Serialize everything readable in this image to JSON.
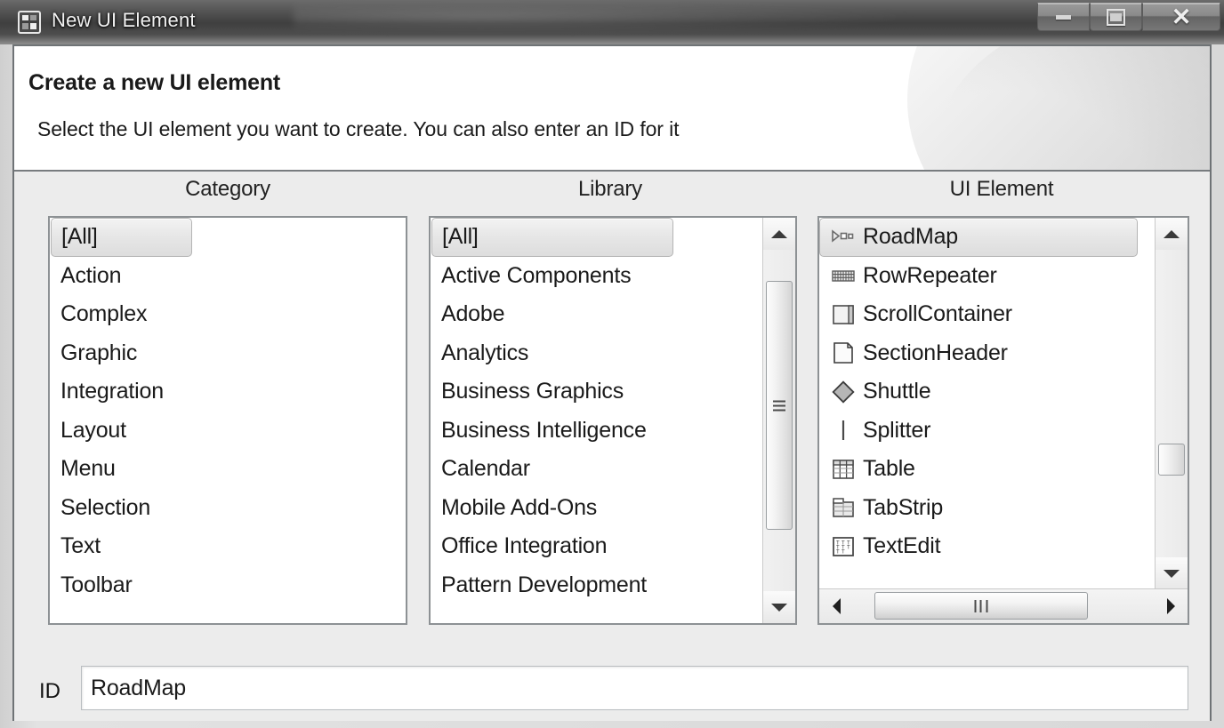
{
  "window": {
    "title": "New UI Element",
    "title_icon": "ui-element-icon",
    "buttons": {
      "minimize": {
        "name": "minimize-button",
        "glyph": "minimize-icon"
      },
      "maximize": {
        "name": "maximize-button",
        "glyph": "maximize-icon"
      },
      "close": {
        "name": "close-button",
        "glyph": "close-icon",
        "label": "✕"
      }
    }
  },
  "banner": {
    "title": "Create a new UI element",
    "subtitle": "Select the UI element you want to create. You can also enter an ID for it"
  },
  "columns": {
    "category": {
      "title": "Category",
      "items": [
        {
          "label": "[All]",
          "selected": true
        },
        {
          "label": "Action",
          "selected": false
        },
        {
          "label": "Complex",
          "selected": false
        },
        {
          "label": "Graphic",
          "selected": false
        },
        {
          "label": "Integration",
          "selected": false
        },
        {
          "label": "Layout",
          "selected": false
        },
        {
          "label": "Menu",
          "selected": false
        },
        {
          "label": "Selection",
          "selected": false
        },
        {
          "label": "Text",
          "selected": false
        },
        {
          "label": "Toolbar",
          "selected": false
        }
      ]
    },
    "library": {
      "title": "Library",
      "items": [
        {
          "label": "[All]",
          "selected": true
        },
        {
          "label": "Active Components",
          "selected": false
        },
        {
          "label": "Adobe",
          "selected": false
        },
        {
          "label": "Analytics",
          "selected": false
        },
        {
          "label": "Business Graphics",
          "selected": false
        },
        {
          "label": "Business Intelligence",
          "selected": false
        },
        {
          "label": "Calendar",
          "selected": false
        },
        {
          "label": "Mobile Add-Ons",
          "selected": false
        },
        {
          "label": "Office Integration",
          "selected": false
        },
        {
          "label": "Pattern Development",
          "selected": false
        }
      ],
      "scrollbar": {
        "thumb_top_pct": 9,
        "thumb_height_pct": 73
      }
    },
    "ui_element": {
      "title": "UI Element",
      "items": [
        {
          "label": "RoadMap",
          "icon": "roadmap-icon",
          "selected": true
        },
        {
          "label": "RowRepeater",
          "icon": "rowrepeater-icon",
          "selected": false
        },
        {
          "label": "ScrollContainer",
          "icon": "scrollcontainer-icon",
          "selected": false
        },
        {
          "label": "SectionHeader",
          "icon": "sectionheader-icon",
          "selected": false
        },
        {
          "label": "Shuttle",
          "icon": "shuttle-icon",
          "selected": false
        },
        {
          "label": "Splitter",
          "icon": "splitter-icon",
          "selected": false
        },
        {
          "label": "Table",
          "icon": "table-icon",
          "selected": false
        },
        {
          "label": "TabStrip",
          "icon": "tabstrip-icon",
          "selected": false
        },
        {
          "label": "TextEdit",
          "icon": "textedit-icon",
          "selected": false
        }
      ],
      "vscrollbar": {
        "thumb_top_pct": 63
      },
      "hscrollbar": {
        "thumb_left_pct": 7,
        "thumb_width_pct": 71
      }
    }
  },
  "footer": {
    "id_label": "ID",
    "id_value": "RoadMap",
    "id_placeholder": ""
  },
  "colors": {
    "window_bg": "#ececec",
    "panel_bg": "#ffffff",
    "border": "#8d9194",
    "text": "#1a1a1a",
    "titlebar_text": "#f2f2f2"
  }
}
